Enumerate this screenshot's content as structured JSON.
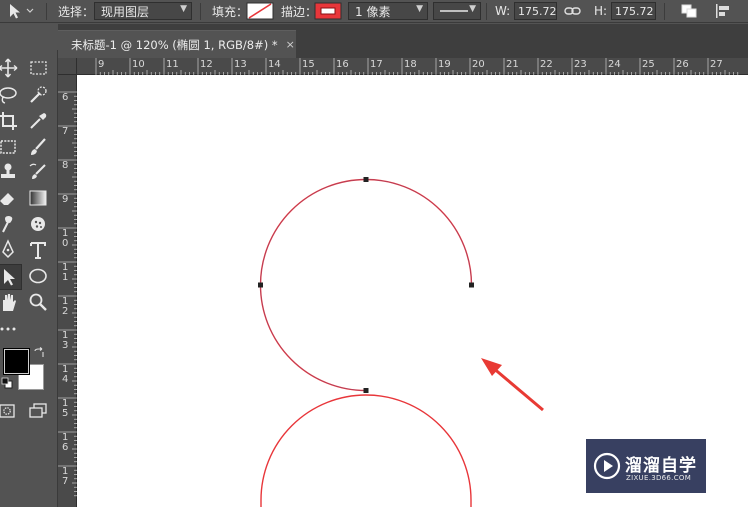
{
  "options_bar": {
    "select_label": "选择：",
    "select_value": "现用图层",
    "fill_label": "填充：",
    "stroke_label": "描边：",
    "stroke_width_value": "1 像素",
    "width_label": "W:",
    "width_value": "175.72 像素",
    "height_label": "H:",
    "height_value": "175.72 像素"
  },
  "tabs": [
    {
      "label": "未标题-1 @ 120% (椭圆 1, RGB/8#) *",
      "close": "×"
    }
  ],
  "ruler_h": [
    "9",
    "10",
    "11",
    "12",
    "13",
    "14",
    "15",
    "16",
    "17",
    "18",
    "19",
    "20",
    "21",
    "22",
    "23",
    "24",
    "25",
    "26",
    "27"
  ],
  "ruler_v": [
    "6",
    "7",
    "8",
    "9",
    "1\n0",
    "1\n1",
    "1\n2",
    "1\n3",
    "1\n4",
    "1\n5",
    "1\n6",
    "1\n7"
  ],
  "toolbox": {
    "icons": [
      "move-icon",
      "marquee-icon",
      "lasso-icon",
      "quick-select-icon",
      "crop-icon",
      "eyedropper-icon",
      "frame-icon",
      "brush-icon",
      "stamp-icon",
      "history-brush-icon",
      "eraser-icon",
      "gradient-icon",
      "smudge-icon",
      "blur-icon",
      "pen-icon",
      "text-icon",
      "path-select-icon",
      "ellipse-icon",
      "hand-icon",
      "zoom-icon",
      "more-icon"
    ]
  },
  "colors": {
    "stroke": "#e8363a",
    "arrow": "#e83a34",
    "anchor": "#222222",
    "foreground": "#000000",
    "background": "#ffffff"
  },
  "watermark": {
    "title": "溜溜自学",
    "url": "ZIXUE.3D66.COM"
  }
}
